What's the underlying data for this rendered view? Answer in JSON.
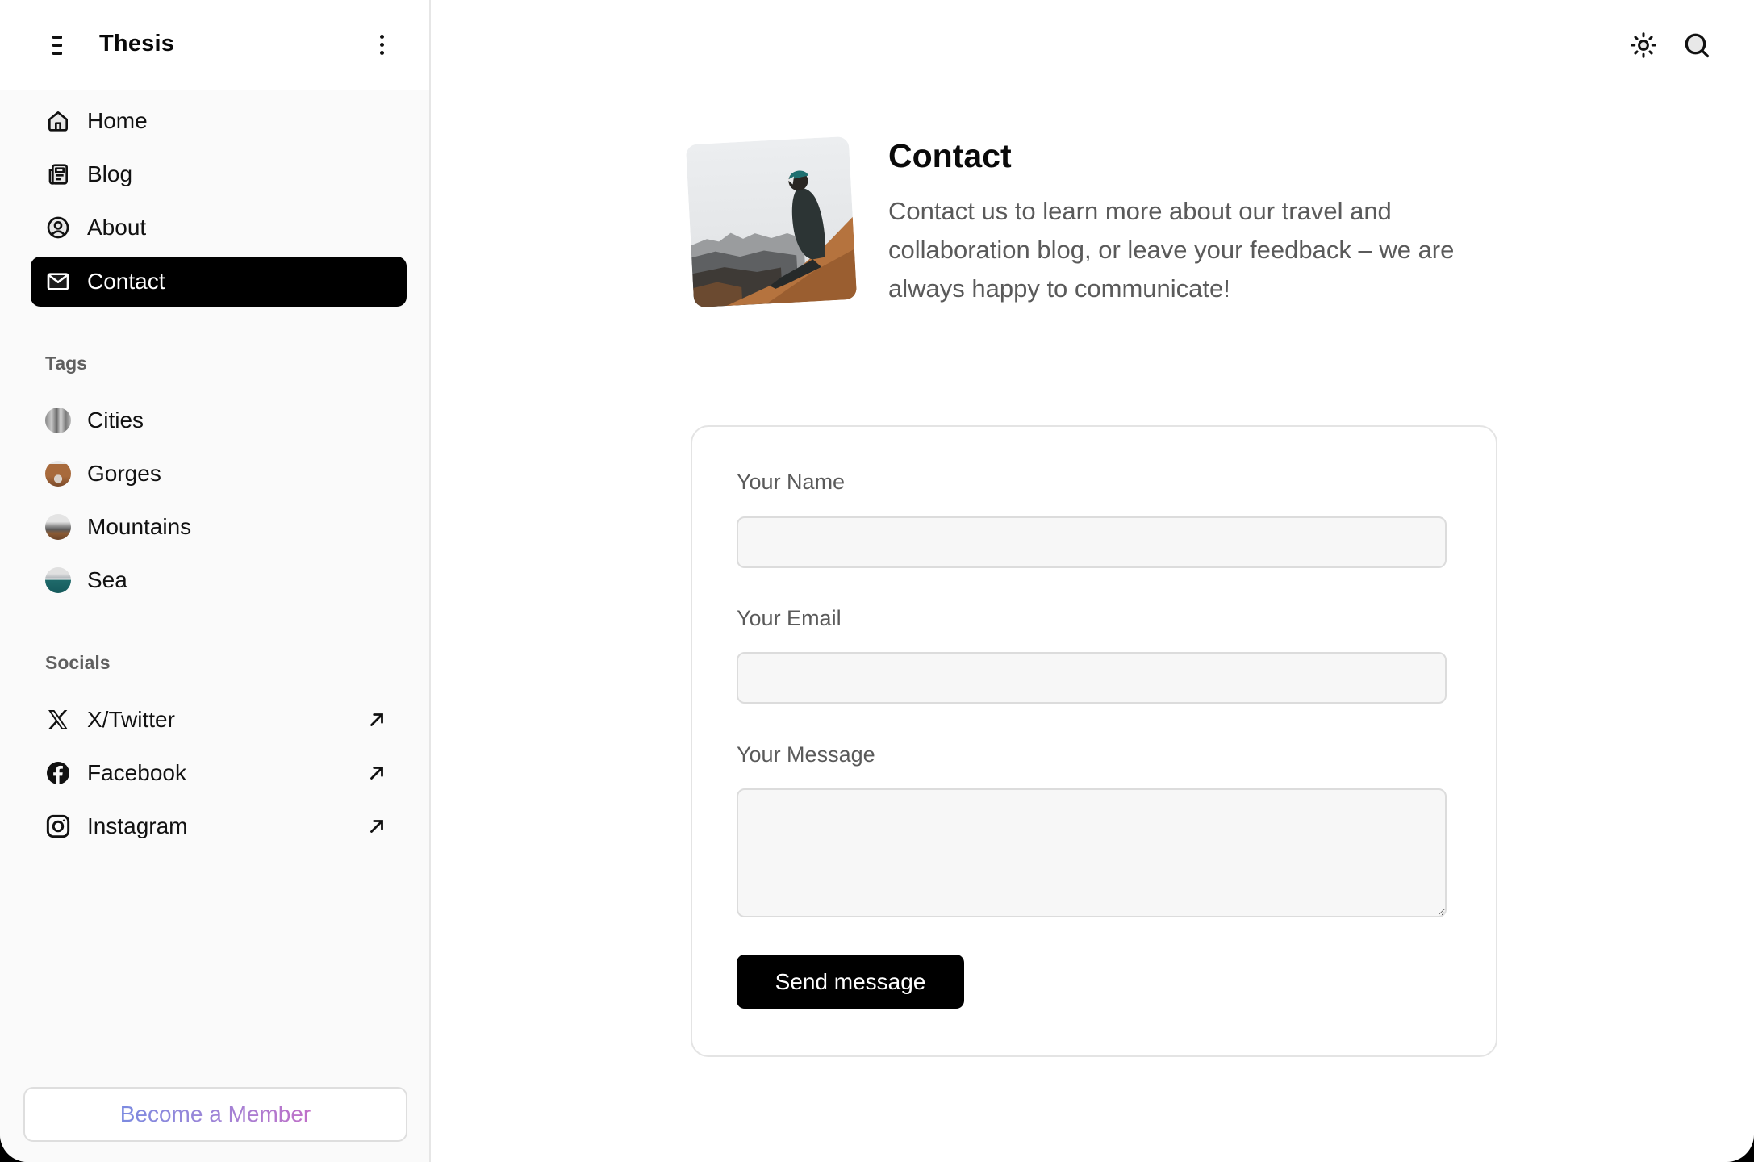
{
  "sidebar": {
    "brand": "Thesis",
    "nav": [
      {
        "label": "Home",
        "icon": "home-icon",
        "active": false
      },
      {
        "label": "Blog",
        "icon": "newspaper-icon",
        "active": false
      },
      {
        "label": "About",
        "icon": "user-circle-icon",
        "active": false
      },
      {
        "label": "Contact",
        "icon": "mail-icon",
        "active": true
      }
    ],
    "tags_label": "Tags",
    "tags": [
      {
        "label": "Cities"
      },
      {
        "label": "Gorges"
      },
      {
        "label": "Mountains"
      },
      {
        "label": "Sea"
      }
    ],
    "socials_label": "Socials",
    "socials": [
      {
        "label": "X/Twitter",
        "icon": "x-twitter-icon"
      },
      {
        "label": "Facebook",
        "icon": "facebook-icon"
      },
      {
        "label": "Instagram",
        "icon": "instagram-icon"
      }
    ],
    "member_button": "Become a Member"
  },
  "topbar": {
    "icons": [
      "sun-icon",
      "search-icon"
    ]
  },
  "hero": {
    "title": "Contact",
    "text": "Contact us to learn more about our travel and collaboration blog, or leave your feedback – we are always happy to communicate!"
  },
  "form": {
    "name_label": "Your Name",
    "name_value": "",
    "email_label": "Your Email",
    "email_value": "",
    "message_label": "Your Message",
    "message_value": "",
    "submit_label": "Send message"
  },
  "colors": {
    "accent": "#000000",
    "member_gradient_start": "#7b8ae0",
    "member_gradient_end": "#c070c8"
  }
}
